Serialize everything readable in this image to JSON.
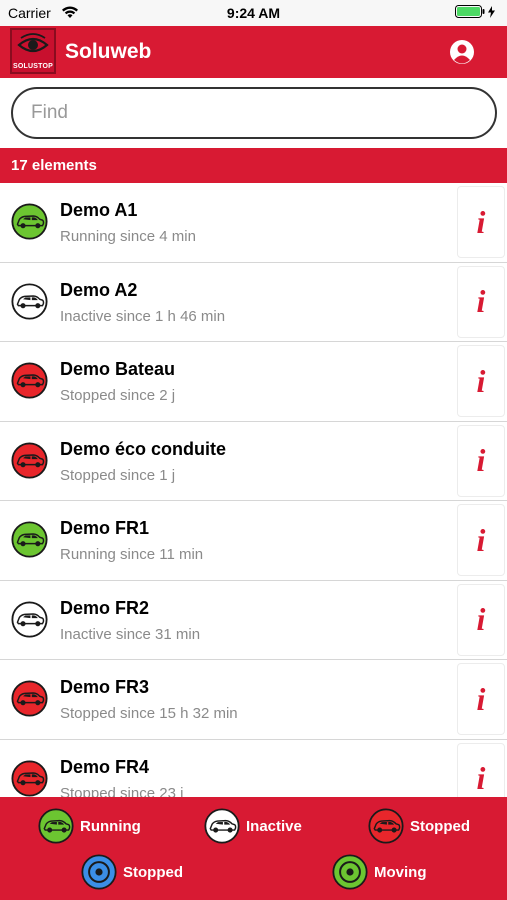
{
  "status_bar": {
    "carrier": "Carrier",
    "time": "9:24 AM"
  },
  "header": {
    "logo_text": "SOLUSTOP",
    "title": "Soluweb",
    "profile_icon": "user-circle-icon"
  },
  "search": {
    "placeholder": "Find",
    "value": ""
  },
  "count_label": "17 elements",
  "colors": {
    "brand_red": "#d81a33",
    "running": "#6cc531",
    "inactive": "#ffffff",
    "stopped": "#e8262b",
    "stopped_blue": "#3b8ee6",
    "moving": "#6cc531"
  },
  "items": [
    {
      "name": "Demo A1",
      "subtitle": "Running since 4 min",
      "status": "running",
      "info_label": "i"
    },
    {
      "name": "Demo A2",
      "subtitle": "Inactive since 1 h 46 min",
      "status": "inactive",
      "info_label": "i"
    },
    {
      "name": "Demo Bateau",
      "subtitle": "Stopped since 2 j",
      "status": "stopped",
      "info_label": "i"
    },
    {
      "name": "Demo éco conduite",
      "subtitle": "Stopped since 1 j",
      "status": "stopped",
      "info_label": "i"
    },
    {
      "name": "Demo FR1",
      "subtitle": "Running since 11 min",
      "status": "running",
      "info_label": "i"
    },
    {
      "name": "Demo FR2",
      "subtitle": "Inactive since 31 min",
      "status": "inactive",
      "info_label": "i"
    },
    {
      "name": "Demo FR3",
      "subtitle": "Stopped since 15 h 32 min",
      "status": "stopped",
      "info_label": "i"
    },
    {
      "name": "Demo FR4",
      "subtitle": "Stopped since 23 j",
      "status": "stopped",
      "info_label": "i"
    }
  ],
  "legend": [
    {
      "label": "Running",
      "icon": "car-icon",
      "color": "#6cc531"
    },
    {
      "label": "Inactive",
      "icon": "car-icon",
      "color": "#ffffff"
    },
    {
      "label": "Stopped",
      "icon": "car-icon",
      "color": "#e8262b"
    },
    {
      "label": "Stopped",
      "icon": "target-icon",
      "color": "#3b8ee6"
    },
    {
      "label": "Moving",
      "icon": "target-icon",
      "color": "#6cc531"
    }
  ]
}
